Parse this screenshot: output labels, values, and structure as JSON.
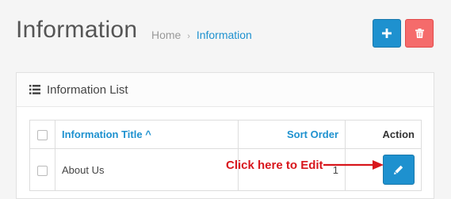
{
  "header": {
    "title": "Information",
    "breadcrumb": [
      {
        "label": "Home"
      },
      {
        "label": "Information"
      }
    ],
    "separator": "›"
  },
  "toolbar": {
    "add_icon": "plus-icon",
    "delete_icon": "trash-icon",
    "add_color": "#1e91cf",
    "delete_color": "#f56b6b"
  },
  "panel": {
    "title": "Information List",
    "icon": "list-icon"
  },
  "table": {
    "columns": [
      "Information Title",
      "Sort Order",
      "Action"
    ],
    "sort_indicator": "^",
    "rows": [
      {
        "title": "About Us",
        "sort_order": "1",
        "action_icon": "pencil-icon"
      }
    ]
  },
  "annotation": {
    "text": "Click here to Edit",
    "color": "#d8161c"
  }
}
